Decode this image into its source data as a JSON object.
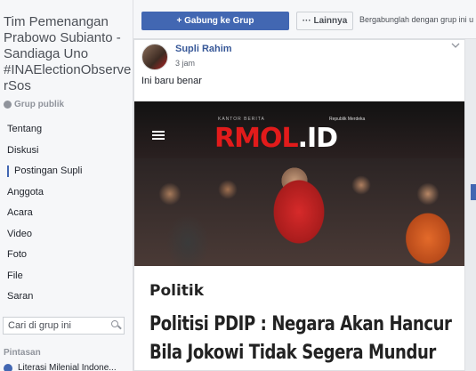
{
  "sidebar": {
    "group_title": "Tim Pemenangan Prabowo Subianto - Sandiaga Uno #INAElectionObserverSos",
    "privacy": "Grup publik",
    "nav": [
      {
        "label": "Tentang"
      },
      {
        "label": "Diskusi"
      },
      {
        "label": "Postingan Supli",
        "active": true
      },
      {
        "label": "Anggota"
      },
      {
        "label": "Acara"
      },
      {
        "label": "Video"
      },
      {
        "label": "Foto"
      },
      {
        "label": "File"
      },
      {
        "label": "Saran"
      }
    ],
    "search_placeholder": "Cari di grup ini",
    "shortcuts_label": "Pintasan",
    "shortcut_item": "Literasi Milenial Indone..."
  },
  "topbar": {
    "join_label": "+ Gabung ke Grup",
    "more_label": "··· Lainnya",
    "join_note": "Bergabunglah dengan grup ini u"
  },
  "post": {
    "author": "Supli Rahim",
    "time": "3 jam",
    "text": "Ini baru benar",
    "article": {
      "portal_label": "KANTOR BERITA",
      "brand": "RMOL",
      "brand_tld": ".ID",
      "brand_sub": "Republik Merdeka",
      "category": "Politik",
      "headline_line1": "Politisi PDIP : Negara Akan Hancur",
      "headline_line2": "Bila Jokowi Tidak Segera Mundur"
    }
  },
  "colors": {
    "accent": "#4267b2",
    "link": "#385898",
    "brand_red": "#e21b1b"
  }
}
